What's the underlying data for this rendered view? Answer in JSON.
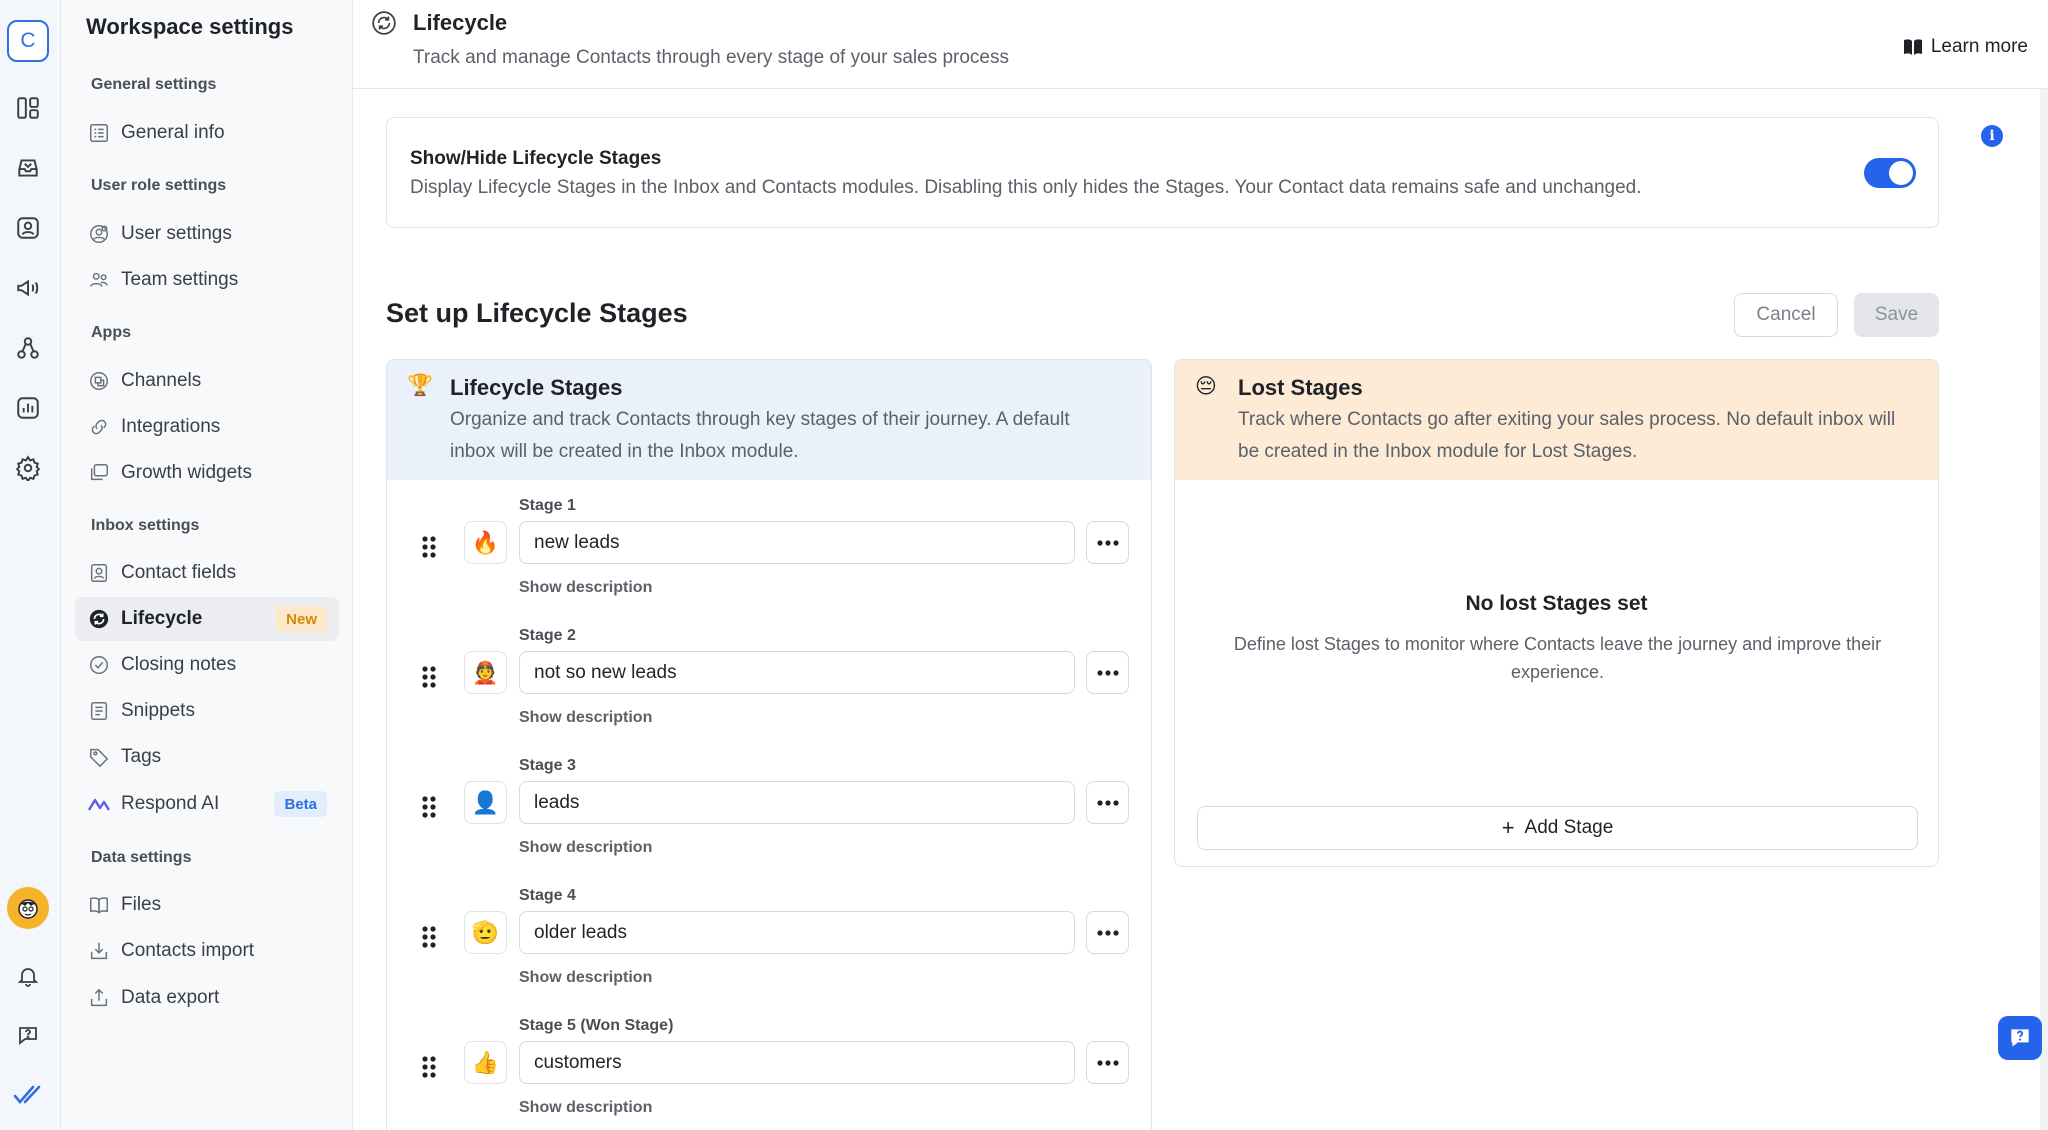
{
  "app": {
    "logo_letter": "C"
  },
  "sidebar": {
    "title": "Workspace settings",
    "sections": [
      {
        "label": "General settings",
        "items": [
          {
            "label": "General info",
            "icon": "info-grid-icon"
          }
        ]
      },
      {
        "label": "User role settings",
        "items": [
          {
            "label": "User settings",
            "icon": "user-gear-icon"
          },
          {
            "label": "Team settings",
            "icon": "team-icon"
          }
        ]
      },
      {
        "label": "Apps",
        "items": [
          {
            "label": "Channels",
            "icon": "channels-icon"
          },
          {
            "label": "Integrations",
            "icon": "link-icon"
          },
          {
            "label": "Growth widgets",
            "icon": "widget-icon"
          }
        ]
      },
      {
        "label": "Inbox settings",
        "items": [
          {
            "label": "Contact fields",
            "icon": "contact-card-icon"
          },
          {
            "label": "Lifecycle",
            "icon": "lifecycle-icon",
            "badge": "New",
            "active": true
          },
          {
            "label": "Closing notes",
            "icon": "check-circle-icon"
          },
          {
            "label": "Snippets",
            "icon": "snippet-icon"
          },
          {
            "label": "Tags",
            "icon": "tag-icon"
          },
          {
            "label": "Respond AI",
            "icon": "respond-ai-icon",
            "badge": "Beta"
          }
        ]
      },
      {
        "label": "Data settings",
        "items": [
          {
            "label": "Files",
            "icon": "book-icon"
          },
          {
            "label": "Contacts import",
            "icon": "import-icon"
          },
          {
            "label": "Data export",
            "icon": "export-icon"
          }
        ]
      }
    ]
  },
  "header": {
    "title": "Lifecycle",
    "subtitle": "Track and manage Contacts through every stage of your sales process",
    "learn_more": "Learn more"
  },
  "toggle_card": {
    "title": "Show/Hide Lifecycle Stages",
    "description": "Display Lifecycle Stages in the Inbox and Contacts modules. Disabling this only hides the Stages. Your Contact data remains safe and unchanged.",
    "enabled": true
  },
  "setup": {
    "title": "Set up Lifecycle Stages",
    "cancel_label": "Cancel",
    "save_label": "Save"
  },
  "lifecycle_panel": {
    "emoji": "🏆",
    "title": "Lifecycle Stages",
    "description": "Organize and track Contacts through key stages of their journey. A default inbox will be created in the Inbox module.",
    "show_description_label": "Show description",
    "stages": [
      {
        "label": "Stage 1",
        "emoji": "🔥",
        "value": "new leads"
      },
      {
        "label": "Stage 2",
        "emoji": "👲",
        "value": "not so new leads"
      },
      {
        "label": "Stage 3",
        "emoji": "👤",
        "value": "leads"
      },
      {
        "label": "Stage 4",
        "emoji": "🫡",
        "value": "older leads"
      },
      {
        "label": "Stage 5 (Won Stage)",
        "emoji": "👍",
        "value": "customers"
      }
    ]
  },
  "lost_panel": {
    "emoji": "😔",
    "title": "Lost Stages",
    "description": "Track where Contacts go after exiting your sales process. No default inbox will be created in the Inbox module for Lost Stages.",
    "empty_title": "No lost Stages set",
    "empty_description": "Define lost Stages to monitor where Contacts leave the journey and improve their experience.",
    "add_label": "Add Stage"
  },
  "colors": {
    "accent": "#2563eb",
    "lifecycle_header_bg": "#eaf1fb",
    "lost_header_bg": "#fdebd6",
    "new_badge_bg": "#fde9c9",
    "beta_badge_bg": "#e3eefc"
  }
}
